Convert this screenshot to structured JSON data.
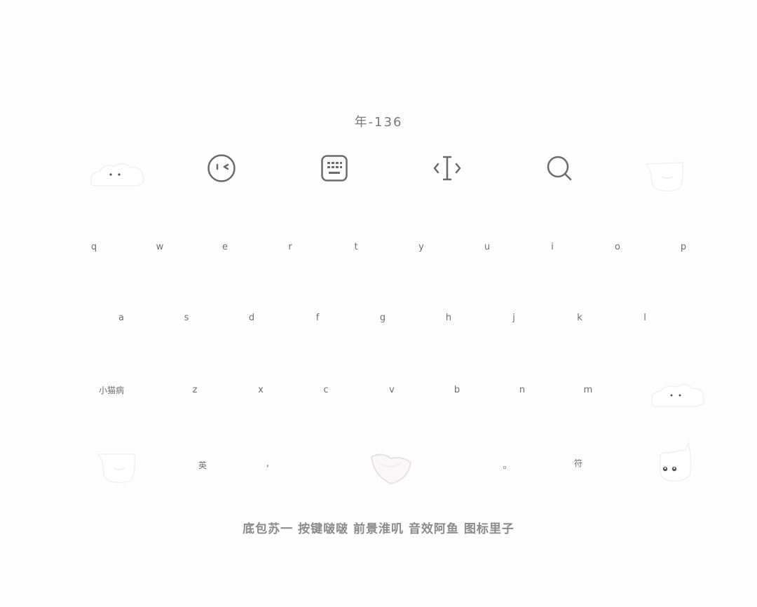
{
  "header": {
    "title": "年-136"
  },
  "toolbar": {
    "items": [
      {
        "icon": "emoji-face-icon"
      },
      {
        "icon": "keyboard-icon"
      },
      {
        "icon": "text-cursor-icon"
      },
      {
        "icon": "search-icon"
      }
    ]
  },
  "keyboard": {
    "row1": [
      "q",
      "w",
      "e",
      "r",
      "t",
      "y",
      "u",
      "i",
      "o",
      "p"
    ],
    "row2": [
      "a",
      "s",
      "d",
      "f",
      "g",
      "h",
      "j",
      "k",
      "l"
    ],
    "row3": [
      "小猫病",
      "z",
      "x",
      "c",
      "v",
      "b",
      "n",
      "m"
    ],
    "row4": {
      "lang": "英",
      "comma": ",",
      "period": "。",
      "symbols": "符"
    }
  },
  "footer": {
    "credits": "底包苏一  按键啵啵  前景淮叽  音效阿鱼  图标里子"
  },
  "colors": {
    "icon": "#6b6b6b",
    "text": "#7a7a7a",
    "background": "#fdfdfd"
  }
}
